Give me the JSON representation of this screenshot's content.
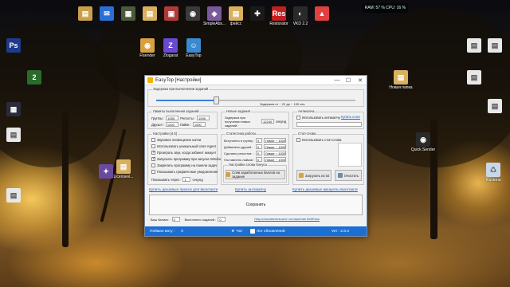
{
  "desktop": {
    "icons_top": [
      {
        "label": "",
        "color": "#c9a04a",
        "glyph": "▤"
      },
      {
        "label": "",
        "color": "#2b6fd6",
        "glyph": "✉"
      },
      {
        "label": "",
        "color": "#4a5a3a",
        "glyph": "▦"
      },
      {
        "label": "",
        "color": "#d8b060",
        "glyph": "▤"
      },
      {
        "label": "",
        "color": "#b03a3a",
        "glyph": "▣"
      },
      {
        "label": "",
        "color": "#3a3a3a",
        "glyph": "◉"
      },
      {
        "label": "SimpleAbs...",
        "color": "#7a5a9a",
        "glyph": "◈"
      },
      {
        "label": "фейсс",
        "color": "#d8b060",
        "glyph": "▤"
      },
      {
        "label": "",
        "color": "#1a1a1a",
        "glyph": "✚"
      },
      {
        "label": "Restorator",
        "color": "#c02020",
        "glyph": "Res"
      },
      {
        "label": "VKD 2.2",
        "color": "#2a2a2a",
        "glyph": "◐"
      },
      {
        "label": "",
        "color": "#e04040",
        "glyph": "▲"
      }
    ],
    "icons_left": [
      {
        "label": "",
        "color": "#1e3a8a",
        "glyph": "Ps"
      },
      {
        "label": "",
        "color": "#2a6a2a",
        "glyph": "2"
      },
      {
        "label": "",
        "color": "#2a2a3a",
        "glyph": "▦"
      },
      {
        "label": "",
        "color": "#e8e8e8",
        "glyph": "▤"
      },
      {
        "label": "",
        "color": "#6a4aa0",
        "glyph": "✦"
      },
      {
        "label": "",
        "color": "#e8e8e8",
        "glyph": "▤"
      },
      {
        "label": "Licensevi...",
        "color": "#d8b060",
        "glyph": "▤"
      }
    ],
    "icons_row2": [
      {
        "label": "Flsender",
        "color": "#d8a040",
        "glyph": "◉"
      },
      {
        "label": "Zlogarat",
        "color": "#6a4ad0",
        "glyph": "Z"
      },
      {
        "label": "EasyTop",
        "color": "#3a8ad0",
        "glyph": "☺"
      }
    ],
    "icons_right": [
      {
        "label": "",
        "color": "#e8e8e8",
        "glyph": "▤"
      },
      {
        "label": "",
        "color": "#e8e8e8",
        "glyph": "▤"
      },
      {
        "label": "Новая папка",
        "color": "#d8b060",
        "glyph": "▤"
      },
      {
        "label": "",
        "color": "#e8e8e8",
        "glyph": "▤"
      },
      {
        "label": "",
        "color": "#e8e8e8",
        "glyph": "▤"
      },
      {
        "label": "Quick Sender",
        "color": "#2a2a2a",
        "glyph": "◉"
      },
      {
        "label": "Корзина",
        "color": "#c8d8e8",
        "glyph": "♺"
      }
    ],
    "tray_text": "RAM: 57 % CPU: 16 %"
  },
  "window": {
    "title": "EasyTop [Настройки]",
    "minimize": "—",
    "maximize": "☐",
    "close": "✕",
    "delay_group": {
      "legend": "Задержка при выполнении заданий",
      "range_text": "Задержка от ~ 22 до ~ 100 сек.",
      "fill_fraction": 0.3
    },
    "limits_group": {
      "legend": "Лимиты выполнения заданий",
      "row1": [
        {
          "label": "Группы :",
          "value": "1000"
        },
        {
          "label": "Репосты :",
          "value": "1000"
        }
      ],
      "row2": [
        {
          "label": "Друзья :",
          "value": "1000"
        },
        {
          "label": "Лайки :",
          "value": "1000"
        }
      ]
    },
    "new_tasks_group": {
      "legend": "Новые задания",
      "label": "Задержка при получении новых заданий :",
      "value": "12240",
      "unit": "секунд"
    },
    "anticaptcha_group": {
      "legend": "Антикапча",
      "checkbox_label": "Использовать антикапчу",
      "link": "Купить ключ"
    },
    "settings_group": {
      "legend": "Настройки [4.5]",
      "options": [
        {
          "label": "Звуковое оповещение капчи",
          "checked": false
        },
        {
          "label": "Использовать уникальный User-Agent",
          "checked": false
        },
        {
          "label": "Проиграть звук, когда забанит аккаунт",
          "checked": true
        },
        {
          "label": "Запускать программу при запуске Windows",
          "checked": true
        },
        {
          "label": "Закрепить программу на панели задач",
          "checked": false
        },
        {
          "label": "Показывать графические уведомления",
          "checked": false
        }
      ],
      "tasks_label": "Показывать через :",
      "tasks_value": "1",
      "tasks_unit": "секунд"
    },
    "stats_group": {
      "legend": "Статистика работы",
      "rows": [
        {
          "label": "Вступлено в группу :",
          "value": "0",
          "limit": "Лимит ~ 1000"
        },
        {
          "label": "Добавлено друзей :",
          "value": "0",
          "limit": "Лимит ~ 1000"
        },
        {
          "label": "Сделано репостов :",
          "value": "0",
          "limit": "Лимит ~ 1000"
        },
        {
          "label": "Поставлено лайков :",
          "value": "0",
          "limit": "Лимит ~ 1000"
        }
      ],
      "bonus_legend": "Настройки слова бонуса",
      "bonus_button": "Слив заработанных баллов на задание"
    },
    "stop_words_group": {
      "legend": "Стоп-слова",
      "checkbox_label": "Использовать стоп-слова",
      "load_button": "Загрузить из txt",
      "clear_button": "Очистить"
    },
    "links": {
      "proxy": "Купить дешевые прокси для вконтакте",
      "anticaptcha": "Купить антикапчу",
      "accounts": "Купить дешевые аккаунты вконтакте"
    },
    "save_button": "Сохранить",
    "status": {
      "balance_label": "Ваш баланс :",
      "balance_value": "0",
      "done_label": "Выполнено заданий :",
      "done_value": "0",
      "agreement_link": "Лиц.пользовательское соглашение ВсёЕась"
    },
    "footer": {
      "points_label": "Поймал вату :",
      "points_value": "0",
      "chat_label": "Чат",
      "log_label": "Лог обновлений",
      "version_label": "Ver : 2.8.3"
    }
  }
}
